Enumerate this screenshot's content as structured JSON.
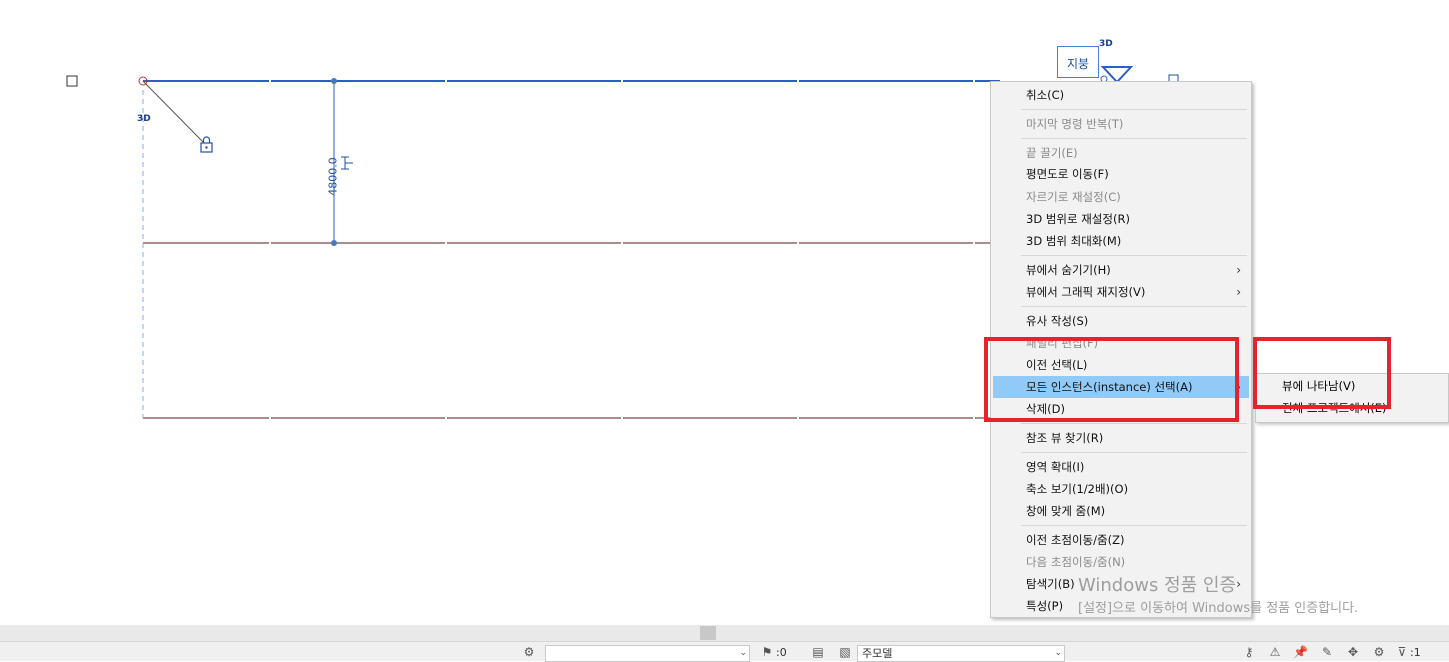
{
  "canvas": {
    "tag_3d": "3D",
    "level_label": "지붕",
    "dimension_text": "4800.0"
  },
  "context_menu": {
    "items": [
      {
        "label": "취소(C)",
        "disabled": false
      },
      {
        "label": "마지막 명령 반복(T)",
        "disabled": true
      },
      {
        "label": "끝 끌기(E)",
        "disabled": true
      },
      {
        "label": "평면도로 이동(F)",
        "disabled": false
      },
      {
        "label": "자르기로 재설정(C)",
        "disabled": true
      },
      {
        "label": "3D 범위로 재설정(R)",
        "disabled": false
      },
      {
        "label": "3D 범위 최대화(M)",
        "disabled": false
      },
      {
        "label": "뷰에서 숨기기(H)",
        "disabled": false,
        "submenu": true
      },
      {
        "label": "뷰에서 그래픽 재지정(V)",
        "disabled": false,
        "submenu": true
      },
      {
        "label": "유사 작성(S)",
        "disabled": false
      },
      {
        "label": "패밀리 편집(F)",
        "disabled": true
      },
      {
        "label": "이전 선택(L)",
        "disabled": false
      },
      {
        "label": "모든 인스턴스(instance) 선택(A)",
        "disabled": false,
        "highlighted": true
      },
      {
        "label": "삭제(D)",
        "disabled": false
      },
      {
        "label": "참조 뷰 찾기(R)",
        "disabled": false
      },
      {
        "label": "영역 확대(I)",
        "disabled": false
      },
      {
        "label": "축소 보기(1/2배)(O)",
        "disabled": false
      },
      {
        "label": "창에 맞게 줌(M)",
        "disabled": false
      },
      {
        "label": "이전 초점이동/줌(Z)",
        "disabled": false
      },
      {
        "label": "다음 초점이동/줌(N)",
        "disabled": true
      },
      {
        "label": "탐색기(B)",
        "disabled": false,
        "submenu": true
      },
      {
        "label": "특성(P)",
        "disabled": false
      }
    ]
  },
  "submenu": {
    "items": [
      {
        "label": "뷰에 나타남(V)"
      },
      {
        "label": "전체 프로젝트에서(E)"
      }
    ]
  },
  "watermark": {
    "title": "Windows 정품 인증",
    "subtitle": "[설정]으로 이동하여 Windows를 정품 인증합니다."
  },
  "status_bar": {
    "workset_value": "",
    "count_label": ":0",
    "model_value": "주모델",
    "filter_count": ":1"
  },
  "colors": {
    "highlight": "#91c9f7",
    "annotation_box": "#e5232a",
    "selection_blue": "#1f4fa3"
  }
}
